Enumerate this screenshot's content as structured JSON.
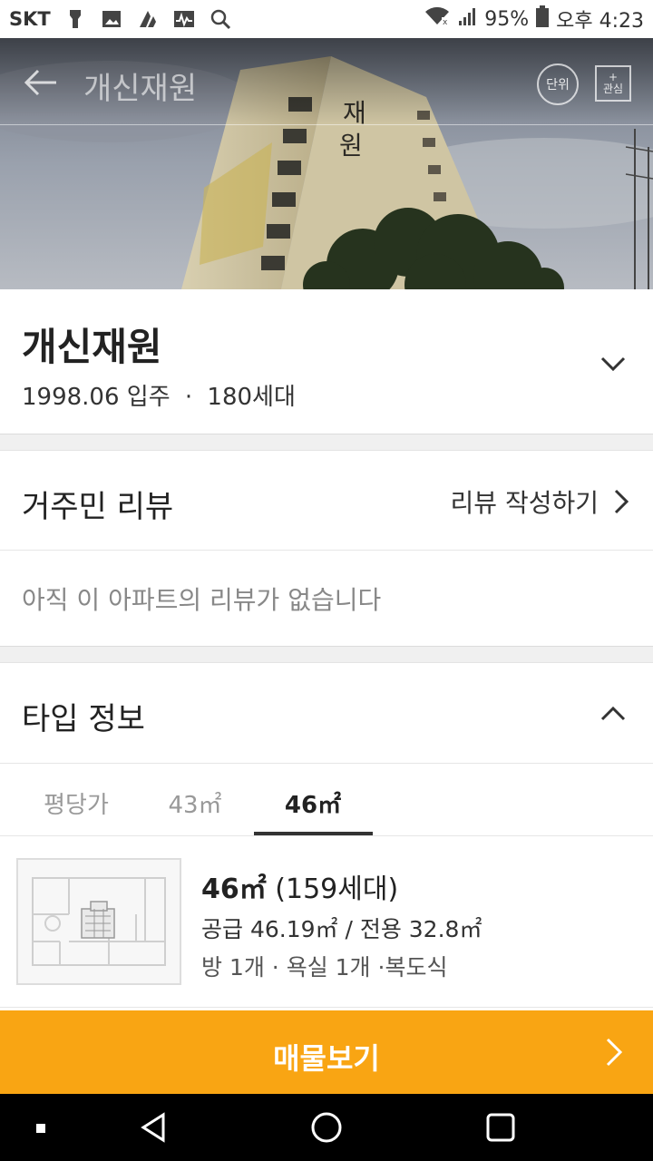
{
  "status_bar": {
    "carrier": "SKT",
    "battery": "95%",
    "time": "오후 4:23",
    "left_icons": [
      "flashlight-icon",
      "gallery-icon",
      "app-icon",
      "activity-icon",
      "search-icon"
    ]
  },
  "header": {
    "title": "개신재원",
    "unit_label": "단위",
    "fav_plus": "+",
    "fav_label": "관심",
    "photo_sign": [
      "재",
      "원"
    ]
  },
  "apartment": {
    "name": "개신재원",
    "move_in": "1998.06 입주",
    "separator": "·",
    "households": "180세대"
  },
  "review": {
    "section_title": "거주민 리뷰",
    "write_label": "리뷰 작성하기",
    "empty_message": "아직 이 아파트의 리뷰가 없습니다"
  },
  "type_info": {
    "section_title": "타입 정보",
    "tabs": [
      {
        "label": "평당가"
      },
      {
        "label": "43㎡"
      },
      {
        "label": "46㎡"
      }
    ],
    "active_tab": 2,
    "card": {
      "size": "46㎡",
      "households": "(159세대)",
      "area": "공급 46.19㎡ / 전용 32.8㎡",
      "rooms": "방 1개 · 욕실 1개 ·복도식"
    }
  },
  "cta": {
    "label": "매물보기"
  },
  "colors": {
    "accent": "#f9a513",
    "text": "#222222",
    "muted": "#888888"
  }
}
